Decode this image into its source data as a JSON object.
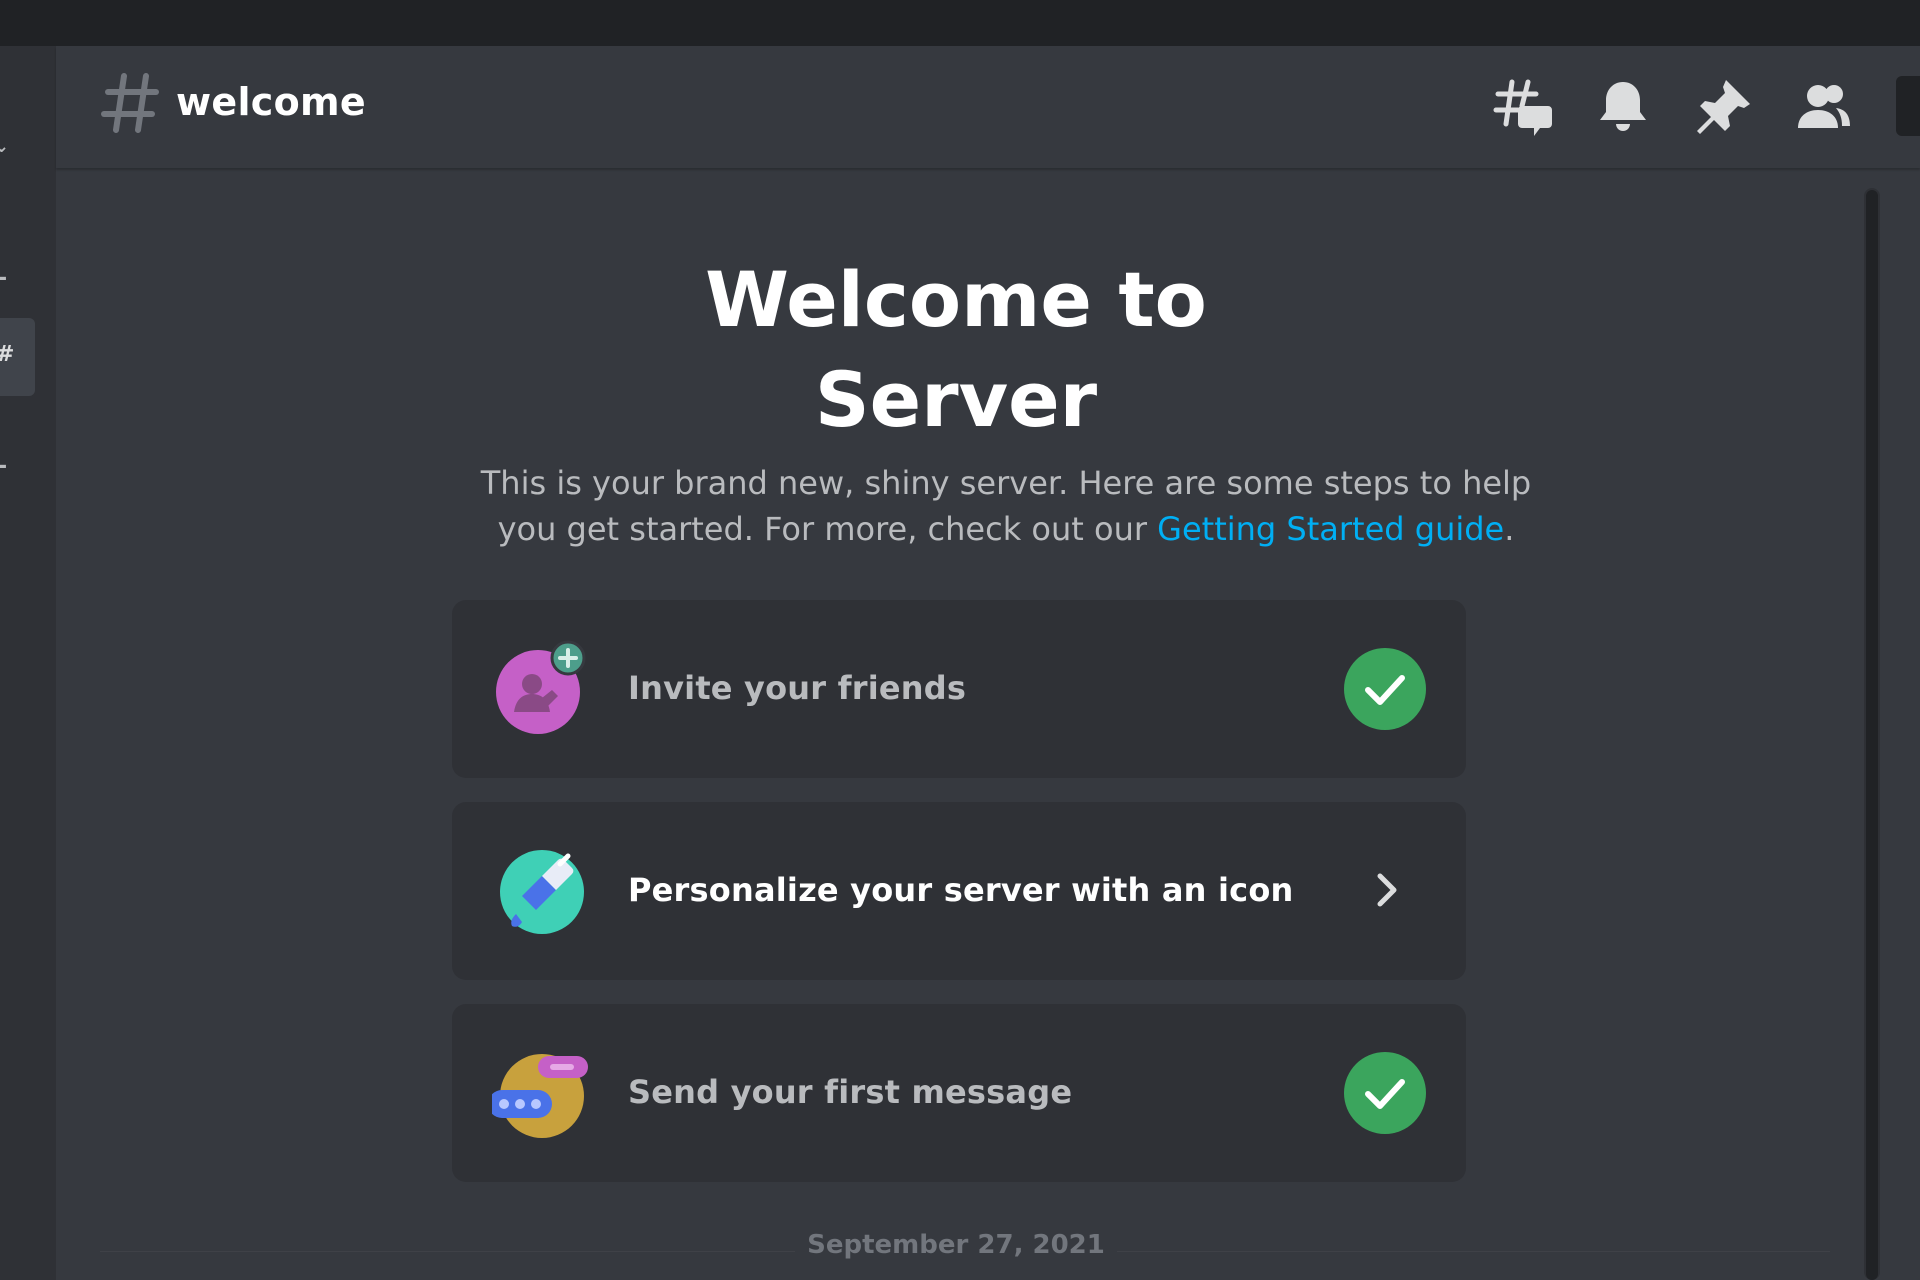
{
  "header": {
    "channel_name": "welcome",
    "icons": [
      "threads-icon",
      "bell-icon",
      "pin-icon",
      "members-icon"
    ]
  },
  "welcome": {
    "title_line1": "Welcome to",
    "title_line2": "Server",
    "description_text": "This is your brand new, shiny server. Here are some steps to help you get started. For more, check out our ",
    "description_link": "Getting Started guide",
    "description_end": "."
  },
  "steps": [
    {
      "label": "Invite your friends",
      "status": "completed",
      "icon": "invite-friends-icon"
    },
    {
      "label": "Personalize your server with an icon",
      "status": "pending",
      "icon": "paintbrush-icon"
    },
    {
      "label": "Send your first message",
      "status": "completed",
      "icon": "message-bubble-icon"
    }
  ],
  "divider": {
    "date": "September 27, 2021"
  },
  "colors": {
    "background": "#36393f",
    "card": "#2f3136",
    "titlebar": "#202225",
    "link": "#00aff4",
    "success": "#3ba55d",
    "text_muted": "#b9bbbe"
  }
}
